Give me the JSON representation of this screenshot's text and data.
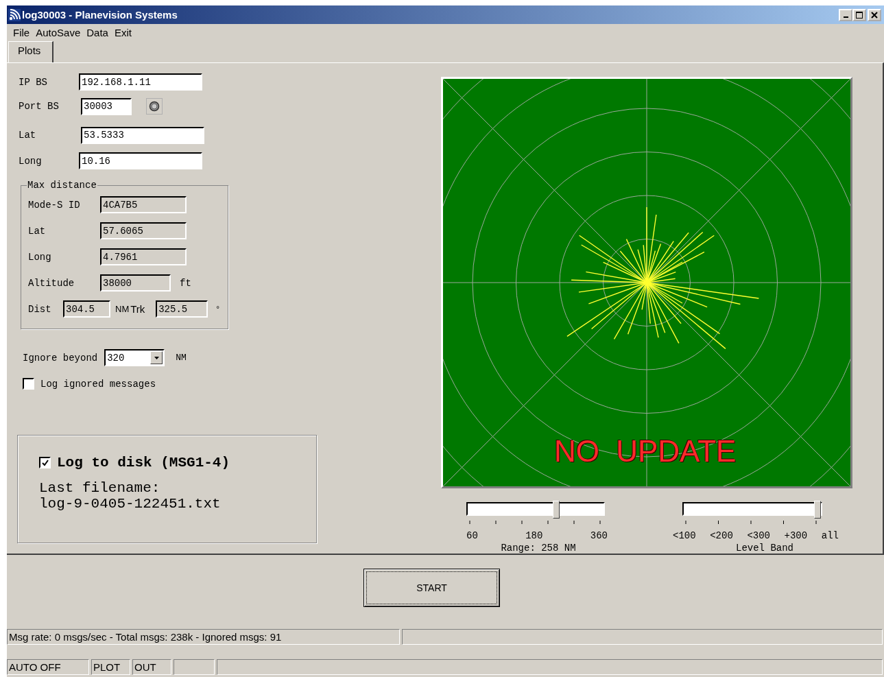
{
  "window": {
    "title": "log30003 - Planevision Systems"
  },
  "menu": [
    "File",
    "AutoSave",
    "Data",
    "Exit"
  ],
  "tabs": [
    {
      "label": "Plots",
      "selected": true
    }
  ],
  "station": [
    {
      "kind": "text",
      "label": "IP BS",
      "value": "192.168.1.11"
    },
    {
      "kind": "port",
      "label": "Port BS",
      "value": "30003"
    },
    {
      "kind": "text",
      "label": "Lat",
      "value": "53.5333"
    },
    {
      "kind": "text",
      "label": "Long",
      "value": "10.16"
    }
  ],
  "max_distance": {
    "title": "Max distance",
    "fields": [
      {
        "label": "Mode-S ID",
        "value": "4CA7B5"
      },
      {
        "label": "Lat",
        "value": "57.6065"
      },
      {
        "label": "Long",
        "value": "4.7961"
      },
      {
        "label": "Altitude",
        "value": "38000",
        "unit": "ft"
      }
    ],
    "dist": {
      "label": "Dist",
      "value": "304.5",
      "unit": "NM"
    },
    "trk": {
      "label": "Trk",
      "value": "325.5",
      "unit": "°"
    }
  },
  "ignore_beyond": {
    "label": "Ignore beyond",
    "value": "320",
    "unit": "NM"
  },
  "log_ignored": {
    "label": "Log ignored messages",
    "checked": false
  },
  "log_disk": {
    "label": "Log to disk (MSG1-4)",
    "checked": true,
    "filename_label": "Last filename:",
    "filename": "log-9-0405-122451.txt"
  },
  "radar": {
    "status": "NO UPDATE"
  },
  "range_slider": {
    "level": 0.66,
    "tick_labels": [
      "60",
      "180",
      "360"
    ],
    "caption": "Range: 258 NM"
  },
  "level_band": {
    "level": 1,
    "tick_labels": [
      "<100",
      "<200",
      "<300",
      "+300",
      "all"
    ],
    "caption": "Level Band"
  },
  "start_button": "START",
  "status_bar": {
    "message": "Msg rate: 0 msgs/sec - Total msgs: 238k - Ignored msgs: 91",
    "cells": [
      "AUTO OFF",
      "PLOT",
      "OUT"
    ]
  }
}
